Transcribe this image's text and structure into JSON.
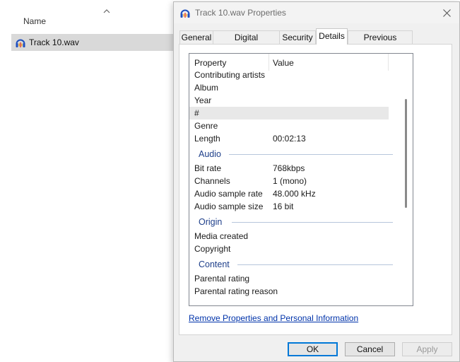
{
  "explorer": {
    "column_header": "Name",
    "file": {
      "name": "Track 10.wav",
      "icon": "audacity-icon"
    }
  },
  "dialog": {
    "title": "Track 10.wav Properties",
    "tabs": [
      {
        "label": "General"
      },
      {
        "label": "Digital Signatures"
      },
      {
        "label": "Security"
      },
      {
        "label": "Details",
        "active": true
      },
      {
        "label": "Previous Versions"
      }
    ],
    "list": {
      "header_property": "Property",
      "header_value": "Value",
      "rows": [
        {
          "property": "Contributing artists",
          "value": ""
        },
        {
          "property": "Album",
          "value": ""
        },
        {
          "property": "Year",
          "value": ""
        },
        {
          "property": "#",
          "value": ""
        },
        {
          "property": "Genre",
          "value": ""
        },
        {
          "property": "Length",
          "value": "00:02:13"
        }
      ],
      "group_audio": "Audio",
      "audio_rows": [
        {
          "property": "Bit rate",
          "value": "768kbps"
        },
        {
          "property": "Channels",
          "value": "1 (mono)"
        },
        {
          "property": "Audio sample rate",
          "value": "48.000 kHz"
        },
        {
          "property": "Audio sample size",
          "value": "16 bit"
        }
      ],
      "group_origin": "Origin",
      "origin_rows": [
        {
          "property": "Media created",
          "value": ""
        },
        {
          "property": "Copyright",
          "value": ""
        }
      ],
      "group_content": "Content",
      "content_rows": [
        {
          "property": "Parental rating",
          "value": ""
        },
        {
          "property": "Parental rating reason",
          "value": ""
        }
      ]
    },
    "remove_link": "Remove Properties and Personal Information",
    "buttons": {
      "ok": "OK",
      "cancel": "Cancel",
      "apply": "Apply"
    }
  }
}
